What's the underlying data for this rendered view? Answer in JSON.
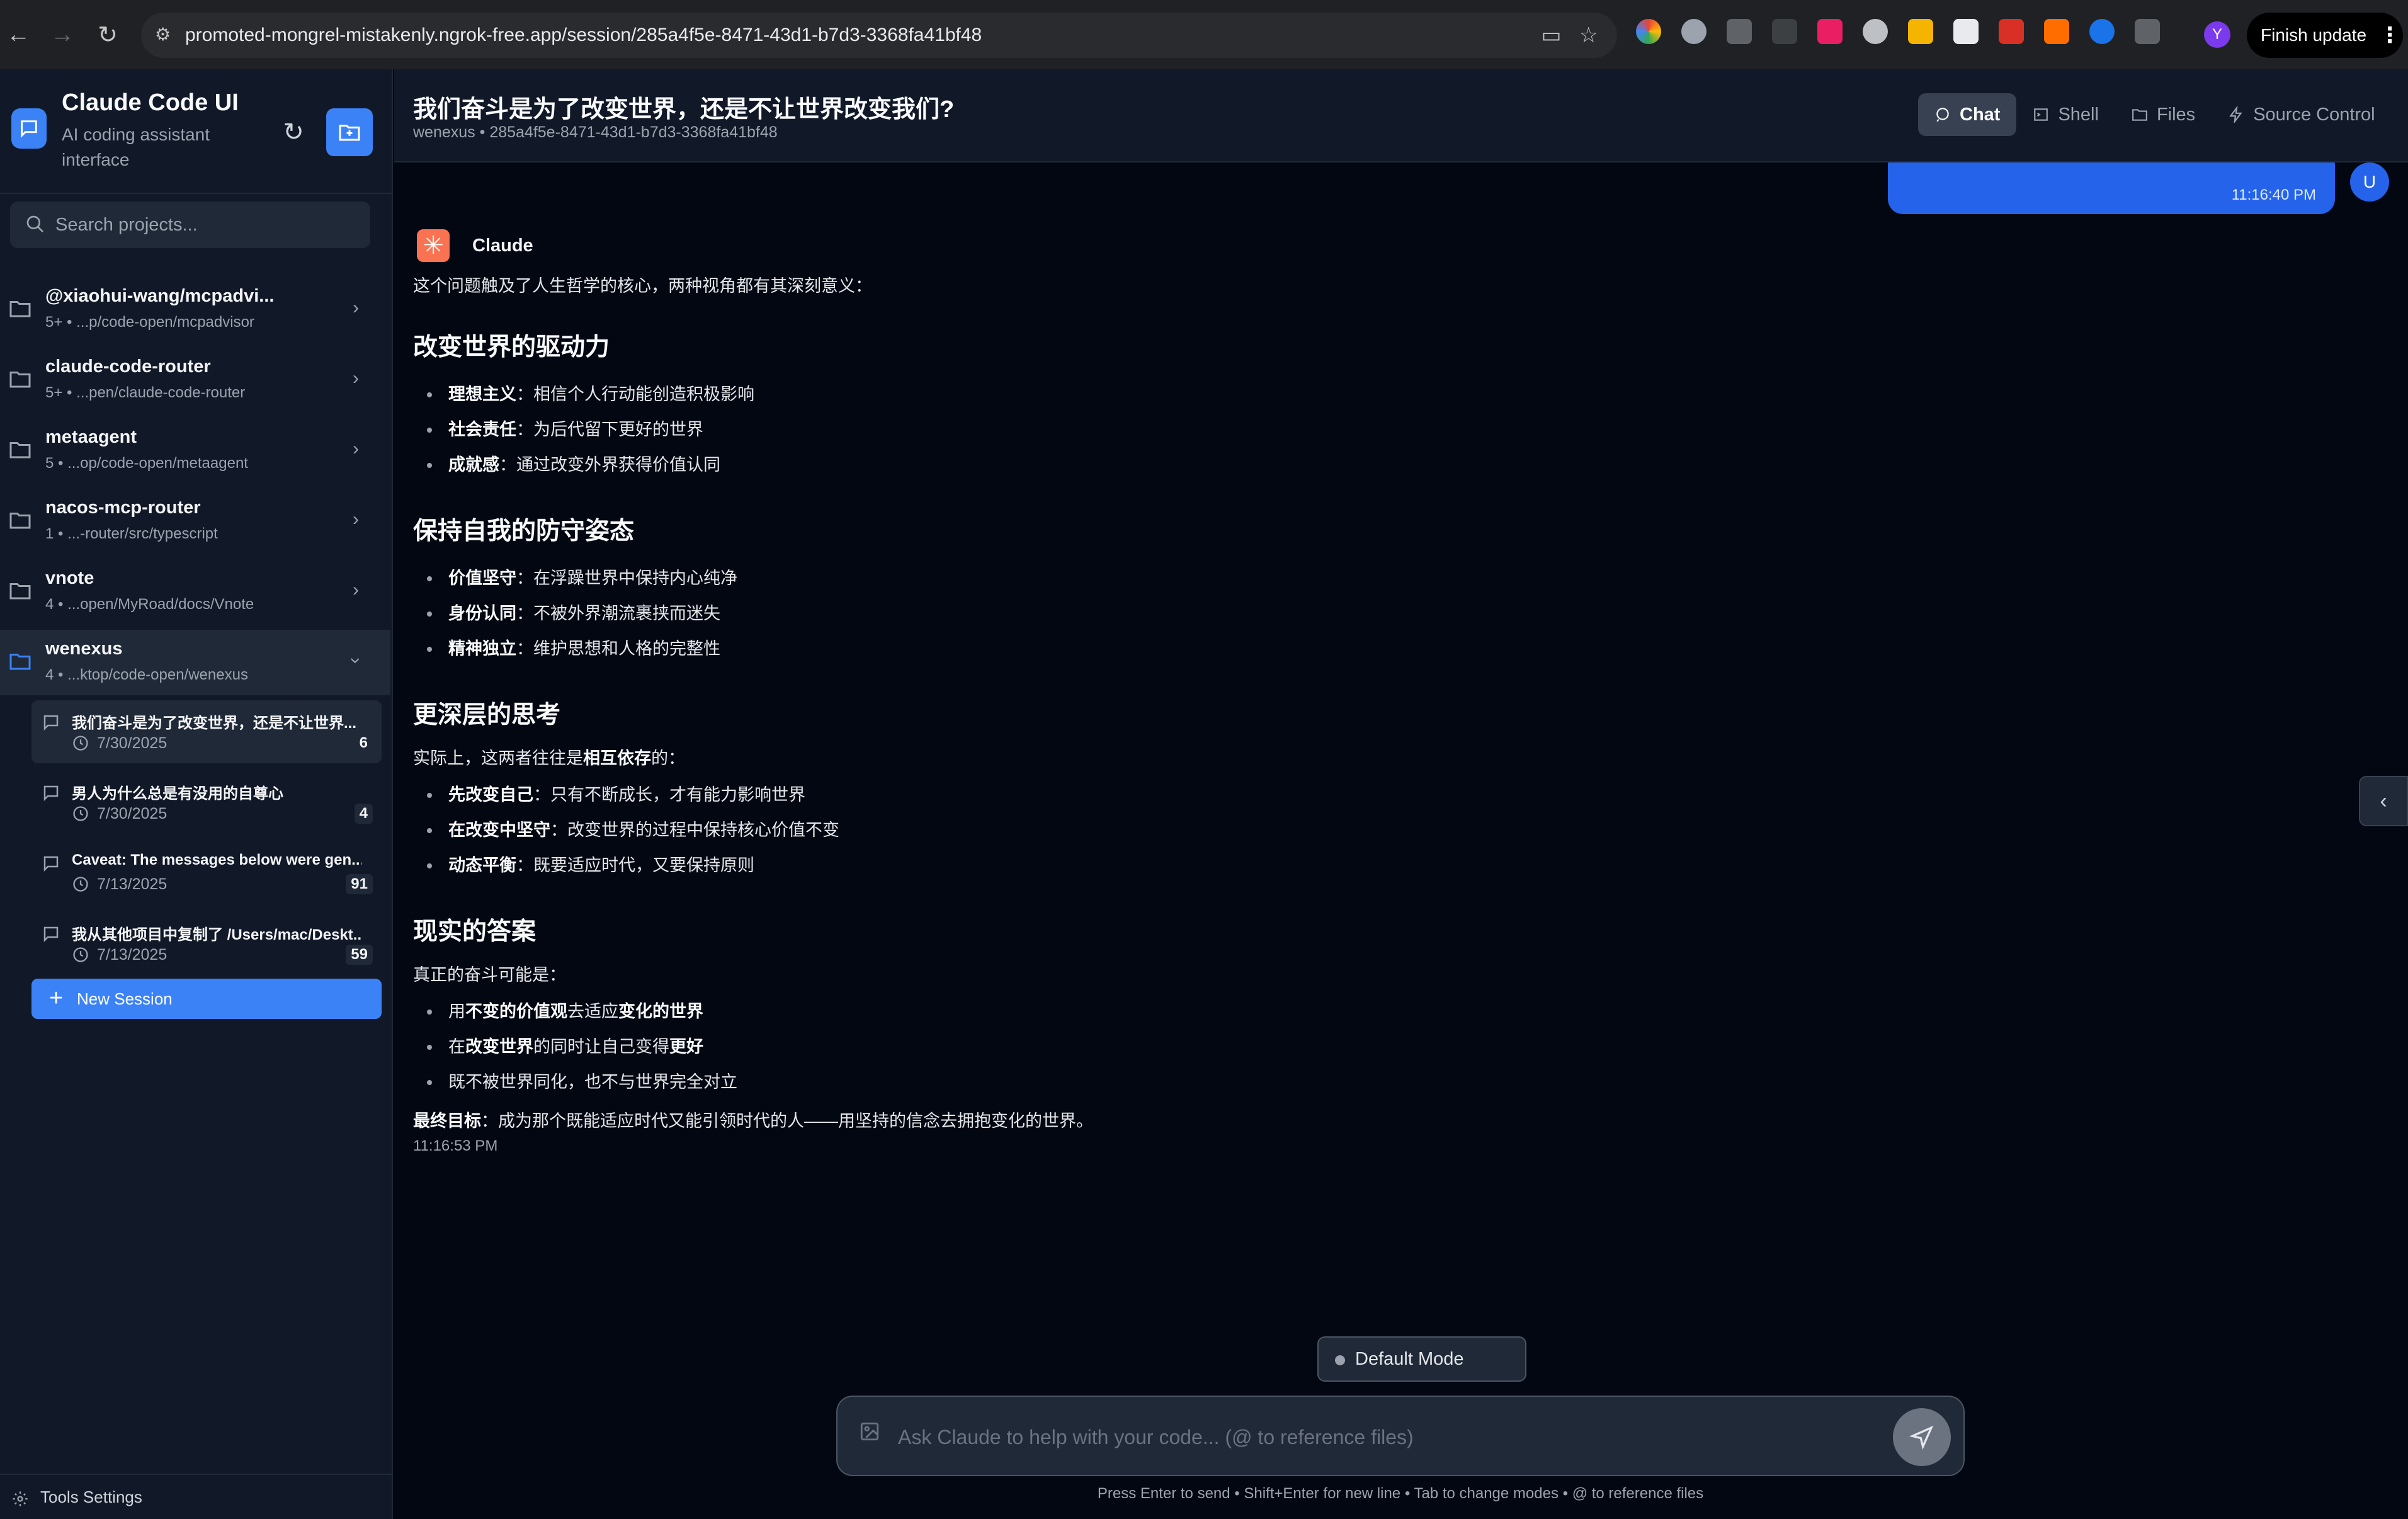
{
  "browser": {
    "url": "promoted-mongrel-mistakenly.ngrok-free.app/session/285a4f5e-8471-43d1-b7d3-3368fa41bf48",
    "profile_initial": "Y",
    "finish_update_label": "Finish update"
  },
  "sidebar": {
    "app_title": "Claude Code UI",
    "app_subtitle": "AI coding assistant interface",
    "search_placeholder": "Search projects...",
    "projects": [
      {
        "name": "@xiaohui-wang/mcpadvi...",
        "meta": "5+ • ...p/code-open/mcpadvisor"
      },
      {
        "name": "claude-code-router",
        "meta": "5+ • ...pen/claude-code-router"
      },
      {
        "name": "metaagent",
        "meta": "5 • ...op/code-open/metaagent"
      },
      {
        "name": "nacos-mcp-router",
        "meta": "1 • ...-router/src/typescript"
      },
      {
        "name": "vnote",
        "meta": "4 • ...open/MyRoad/docs/Vnote"
      },
      {
        "name": "wenexus",
        "meta": "4 • ...ktop/code-open/wenexus"
      }
    ],
    "sessions": [
      {
        "title": "我们奋斗是为了改变世界，还是不让世界...",
        "date": "7/30/2025",
        "count": "6"
      },
      {
        "title": "男人为什么总是有没用的自尊心",
        "date": "7/30/2025",
        "count": "4"
      },
      {
        "title": "Caveat: The messages below were gen...",
        "date": "7/13/2025",
        "count": "91"
      },
      {
        "title": "我从其他项目中复制了 /Users/mac/Deskt...",
        "date": "7/13/2025",
        "count": "59"
      }
    ],
    "new_session_label": "New Session",
    "tools_settings_label": "Tools Settings"
  },
  "header": {
    "title": "我们奋斗是为了改变世界，还是不让世界改变我们?",
    "subtitle": "wenexus • 285a4f5e-8471-43d1-b7d3-3368fa41bf48",
    "tabs": [
      "Chat",
      "Shell",
      "Files",
      "Source Control"
    ]
  },
  "chat": {
    "user_time": "11:16:40 PM",
    "user_avatar": "U",
    "assistant_name": "Claude",
    "intro": "这个问题触及了人生哲学的核心，两种视角都有其深刻意义：",
    "section1_title": "改变世界的驱动力",
    "section1_items": [
      {
        "bold": "理想主义",
        "text": "：相信个人行动能创造积极影响"
      },
      {
        "bold": "社会责任",
        "text": "：为后代留下更好的世界"
      },
      {
        "bold": "成就感",
        "text": "：通过改变外界获得价值认同"
      }
    ],
    "section2_title": "保持自我的防守姿态",
    "section2_items": [
      {
        "bold": "价值坚守",
        "text": "：在浮躁世界中保持内心纯净"
      },
      {
        "bold": "身份认同",
        "text": "：不被外界潮流裹挟而迷失"
      },
      {
        "bold": "精神独立",
        "text": "：维护思想和人格的完整性"
      }
    ],
    "section3_title": "更深层的思考",
    "section3_intro_pre": "实际上，这两者往往是",
    "section3_intro_bold": "相互依存",
    "section3_intro_post": "的：",
    "section3_items": [
      {
        "bold": "先改变自己",
        "text": "：只有不断成长，才有能力影响世界"
      },
      {
        "bold": "在改变中坚守",
        "text": "：改变世界的过程中保持核心价值不变"
      },
      {
        "bold": "动态平衡",
        "text": "：既要适应时代，又要保持原则"
      }
    ],
    "section4_title": "现实的答案",
    "section4_intro": "真正的奋斗可能是：",
    "s4_item1": {
      "p1": "用",
      "b1": "不变的价值观",
      "p2": "去适应",
      "b2": "变化的世界"
    },
    "s4_item2": {
      "p1": "在",
      "b1": "改变世界",
      "p2": "的同时让自己变得",
      "b2": "更好"
    },
    "s4_item3": "既不被世界同化，也不与世界完全对立",
    "final_bold": "最终目标",
    "final_text": "：成为那个既能适应时代又能引领时代的人——用坚持的信念去拥抱变化的世界。",
    "assistant_time": "11:16:53 PM"
  },
  "composer": {
    "mode_label": "Default Mode",
    "placeholder": "Ask Claude to help with your code... (@ to reference files)",
    "hint": "Press Enter to send • Shift+Enter for new line • Tab to change modes • @ to reference files"
  },
  "colors": {
    "accent": "#3b82f6",
    "background": "#030712",
    "sidebar": "#111827"
  }
}
